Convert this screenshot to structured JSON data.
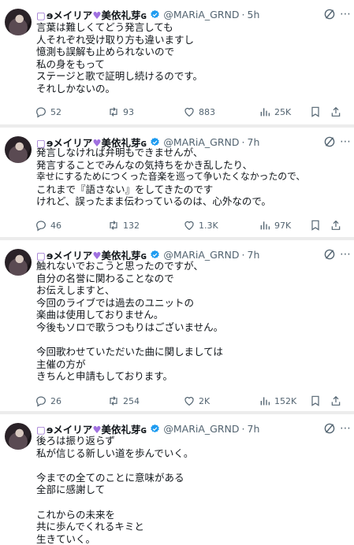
{
  "author": {
    "deco_left": "ɘ",
    "name": "メイリア",
    "heart": "💜",
    "name2": "美依礼芽",
    "deco_right": "ɢ",
    "handle": "@MARiA_GRND"
  },
  "tweets": [
    {
      "time": "5h",
      "lines": [
        "言葉は難しくてどう発言しても",
        "人それぞれ受け取り方も違いますし",
        "憶測も誤解も止められないので",
        "私の身をもって",
        "ステージと歌で証明し続けるのです。",
        "それしかないの。"
      ],
      "replies": "52",
      "reposts": "93",
      "likes": "883",
      "views": "25K"
    },
    {
      "time": "7h",
      "lines": [
        "発言しなければ弁明もできませんが、",
        "発言することでみんなの気持ちをかき乱したり、",
        "幸せにするためにつくった音楽を巡って争いたくなかったので、",
        "これまで『語さない』をしてきたのです",
        "けれど、誤ったまま伝わっているのは、心外なので。"
      ],
      "replies": "46",
      "reposts": "132",
      "likes": "1.3K",
      "views": "97K"
    },
    {
      "time": "7h",
      "lines": [
        "触れないでおこうと思ったのですが、",
        "自分の名誉に関わることなので",
        "お伝えしますと、",
        "今回のライブでは過去のユニットの",
        "楽曲は使用しておりません。",
        "今後もソロで歌うつもりはございません。",
        "",
        "今回歌わせていただいた曲に関しましては",
        "主催の方が",
        "きちんと申請もしております。"
      ],
      "replies": "26",
      "reposts": "254",
      "likes": "2K",
      "views": "152K"
    },
    {
      "time": "7h",
      "lines": [
        "後ろは振り返らず",
        "私が信じる新しい道を歩んでいく。",
        "",
        "今までの全てのことに意味がある",
        "全部に感謝して",
        "",
        "これからの未来を",
        "共に歩んでくれるキミと",
        "生きていく。"
      ]
    }
  ],
  "colors": {
    "text": "#0f1419",
    "secondary": "#536471",
    "verified": "#1d9bf0",
    "background": "#ececec"
  },
  "icons": [
    "reply-icon",
    "repost-icon",
    "like-icon",
    "views-icon",
    "bookmark-icon",
    "share-icon",
    "verified-icon",
    "grok-icon",
    "more-icon"
  ]
}
